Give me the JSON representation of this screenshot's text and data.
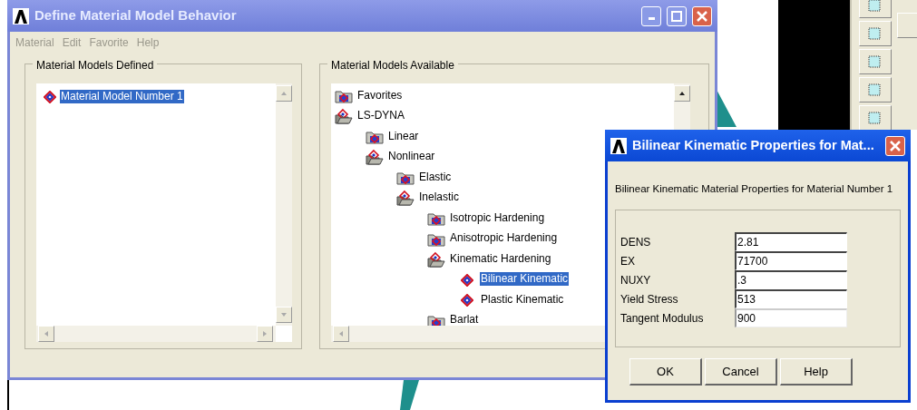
{
  "main_window": {
    "title": "Define Material Model Behavior",
    "menu": [
      "Material",
      "Edit",
      "Favorite",
      "Help"
    ],
    "defined_panel": {
      "title": "Material Models Defined",
      "items": [
        {
          "label": "Material Model Number 1",
          "selected": true
        }
      ]
    },
    "available_panel": {
      "title": "Material Models Available",
      "tree": [
        {
          "label": "Favorites",
          "kind": "folder",
          "expanded": false,
          "selected": false
        },
        {
          "label": "LS-DYNA",
          "kind": "folder",
          "expanded": true,
          "selected": false,
          "children": [
            {
              "label": "Linear",
              "kind": "folder",
              "expanded": false,
              "selected": false
            },
            {
              "label": "Nonlinear",
              "kind": "folder",
              "expanded": true,
              "selected": false,
              "children": [
                {
                  "label": "Elastic",
                  "kind": "folder",
                  "expanded": false,
                  "selected": false
                },
                {
                  "label": "Inelastic",
                  "kind": "folder",
                  "expanded": true,
                  "selected": false,
                  "children": [
                    {
                      "label": "Isotropic Hardening",
                      "kind": "folder",
                      "expanded": false,
                      "selected": false
                    },
                    {
                      "label": "Anisotropic Hardening",
                      "kind": "folder",
                      "expanded": false,
                      "selected": false
                    },
                    {
                      "label": "Kinematic Hardening",
                      "kind": "folder",
                      "expanded": true,
                      "selected": false,
                      "children": [
                        {
                          "label": "Bilinear Kinematic",
                          "kind": "model",
                          "selected": true
                        },
                        {
                          "label": "Plastic Kinematic",
                          "kind": "model",
                          "selected": false
                        }
                      ]
                    },
                    {
                      "label": "Barlat",
                      "kind": "folder",
                      "expanded": false,
                      "selected": false
                    }
                  ]
                }
              ]
            }
          ]
        }
      ]
    }
  },
  "dialog": {
    "title": "Bilinear Kinematic Properties for Mat...",
    "heading": "Bilinear Kinematic Material Properties for Material Number 1",
    "fields": [
      {
        "label": "DENS",
        "value": "2.81",
        "focused": false
      },
      {
        "label": "EX",
        "value": "71700",
        "focused": false
      },
      {
        "label": "NUXY",
        "value": ".3",
        "focused": false
      },
      {
        "label": "Yield Stress",
        "value": "513",
        "focused": false
      },
      {
        "label": "Tangent Modulus",
        "value": "900",
        "focused": true
      }
    ],
    "buttons": [
      "OK",
      "Cancel",
      "Help"
    ]
  }
}
